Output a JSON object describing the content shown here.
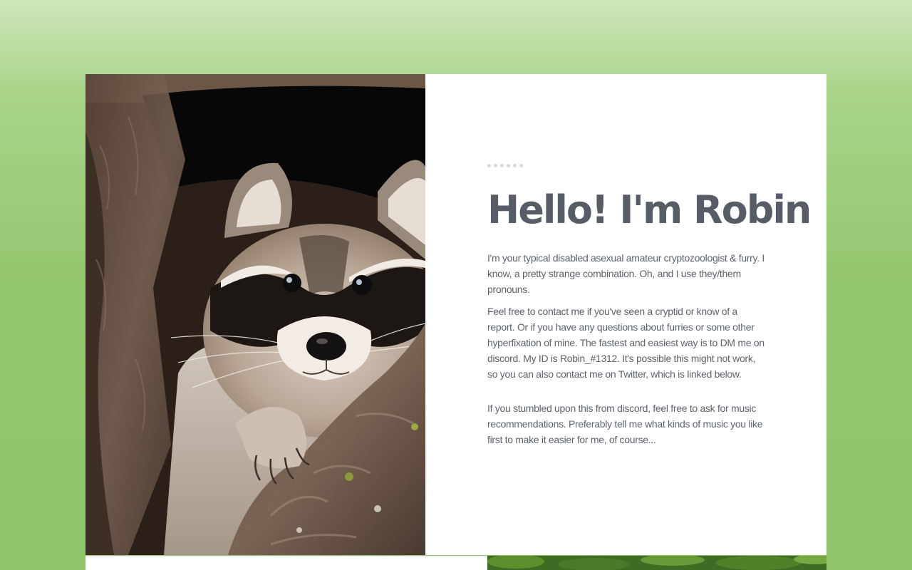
{
  "hero": {
    "image_alt": "raccoon peeking out of a tree hollow",
    "title": "Hello! I'm Robin",
    "paragraphs": [
      "I'm your typical disabled asexual amateur cryptozoologist & furry. I know, a pretty strange combination. Oh, and I use they/them pronouns.",
      "Feel free to contact me if you've seen a cryptid or know of a report. Or if you have any questions about furries or some other hyperfixation of mine. The fastest and easiest way is to DM me on discord. My ID is Robin_#1312. It's possible this might not work, so you can also contact me on Twitter, which is linked below.",
      "If you stumbled upon this from discord, feel free to ask for music recommendations. Preferably tell me what kinds of music you like first to make it easier for me, of course..."
    ]
  },
  "colors": {
    "background_top": "#cde6bb",
    "background_bottom": "#8fc46a",
    "title": "#565d66",
    "body_text": "#5d646c"
  }
}
